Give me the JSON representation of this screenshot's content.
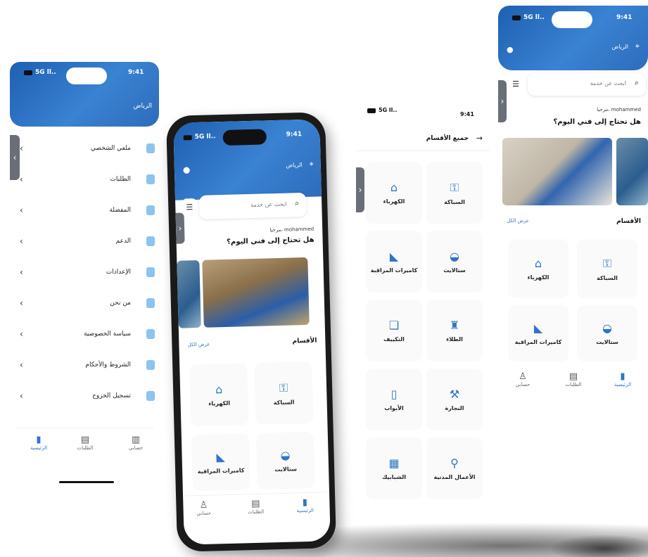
{
  "status": {
    "time": "9:41",
    "carrier": "5G ll..",
    "battery": "100"
  },
  "home": {
    "location": "الرياض",
    "search_placeholder": "ابحث عن خدمة",
    "greeting_user": "مرحبا، mohammed",
    "greeting_question": "هل تحتاج إلى فني اليوم؟",
    "sections_title": "الأقسام",
    "see_all": "عرض الكل"
  },
  "categories": [
    {
      "label": "الكهرباء",
      "icon": "house-plug-icon"
    },
    {
      "label": "السباكة",
      "icon": "faucet-icon"
    },
    {
      "label": "كاميرات المراقبة",
      "icon": "camera-icon"
    },
    {
      "label": "ستالايت",
      "icon": "satellite-dish-icon"
    },
    {
      "label": "التكييف",
      "icon": "ac-icon"
    },
    {
      "label": "الطلاء",
      "icon": "paint-roller-icon"
    },
    {
      "label": "الأبواب",
      "icon": "door-icon"
    },
    {
      "label": "النجارة",
      "icon": "saw-icon"
    },
    {
      "label": "الشبابيك",
      "icon": "window-icon"
    },
    {
      "label": "الأعمال المدنية",
      "icon": "shovel-icon"
    }
  ],
  "categories_page_title": "جميع الأقسام",
  "menu": {
    "items": [
      {
        "label": "ملفي الشخصي"
      },
      {
        "label": "الطلبات"
      },
      {
        "label": "المفضلة"
      },
      {
        "label": "الدعم"
      },
      {
        "label": "الإعدادات"
      },
      {
        "label": "من نحن"
      },
      {
        "label": "سياسة الخصوصية"
      },
      {
        "label": "الشروط والأحكام"
      },
      {
        "label": "تسجيل الخروج"
      }
    ]
  },
  "tabbar": [
    {
      "label": "الرئيسية",
      "icon": "home-icon"
    },
    {
      "label": "الطلبات",
      "icon": "orders-icon"
    },
    {
      "label": "حسابي",
      "icon": "user-icon"
    }
  ],
  "colors": {
    "primary": "#2f74c8",
    "primary_dark": "#1e5fb0",
    "background": "#ffffff"
  }
}
